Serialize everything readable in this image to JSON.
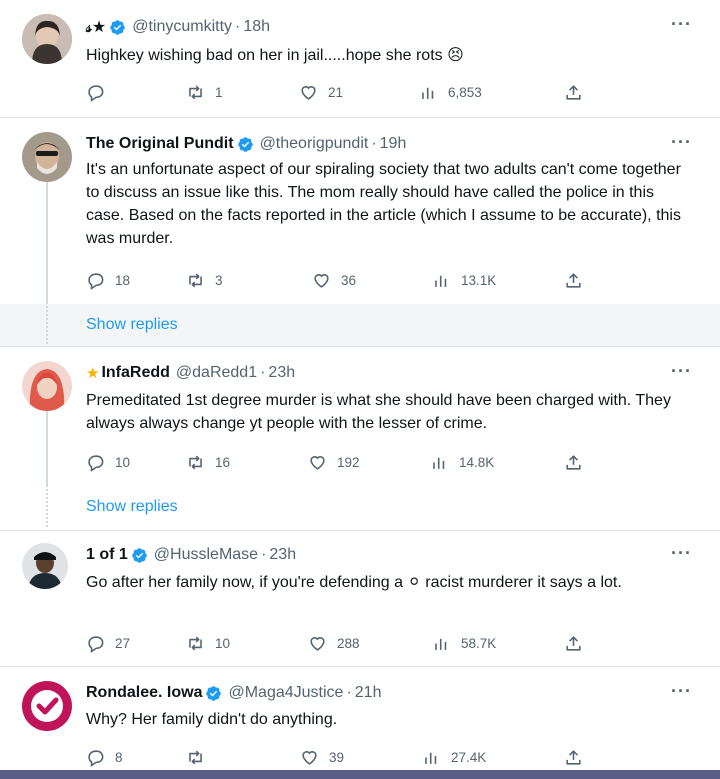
{
  "tweets": [
    {
      "name": "𝓈★",
      "handle": "@tinycumkitty",
      "time": "18h",
      "text": "Highkey wishing bad on her in jail.....hope she rots 😣",
      "replies": "",
      "retweets": "1",
      "likes": "21",
      "views": "6,853"
    },
    {
      "name": "The Original Pundit",
      "handle": "@theorigpundit",
      "time": "19h",
      "text": "It's an unfortunate aspect of our spiraling society that two adults can't come together to discuss an issue like this. The mom really should have called the police in this case. Based on the facts reported in the article (which I assume to be accurate), this was murder.",
      "replies": "18",
      "retweets": "3",
      "likes": "36",
      "views": "13.1K"
    },
    {
      "name": "InfaRedd",
      "handle": "@daRedd1",
      "time": "23h",
      "text": "Premeditated 1st degree murder is what she should have been charged with. They always always change yt people with the lesser of crime.",
      "replies": "10",
      "retweets": "16",
      "likes": "192",
      "views": "14.8K"
    },
    {
      "name": "1 of 1",
      "handle": "@HussleMase",
      "time": "23h",
      "text": "Go after her family now, if you're defending a ⚪ racist murderer it says a lot.",
      "replies": "27",
      "retweets": "10",
      "likes": "288",
      "views": "58.7K"
    },
    {
      "name": "Rondalee. Iowa",
      "handle": "@Maga4Justice",
      "time": "21h",
      "text": "Why? Her family didn't do anything.",
      "replies": "8",
      "retweets": "",
      "likes": "39",
      "views": "27.4K"
    }
  ],
  "show_replies_label": "Show replies",
  "more_label": "···",
  "time_separator": "·",
  "icons": {
    "verified": "verified-badge-icon",
    "reply": "reply-icon",
    "retweet": "retweet-icon",
    "like": "heart-icon",
    "views": "views-chart-icon",
    "share": "share-icon"
  },
  "colors": {
    "verified": "#1d9bf0",
    "link": "#1d9bf0",
    "muted": "#536471",
    "text": "#0f1419"
  }
}
